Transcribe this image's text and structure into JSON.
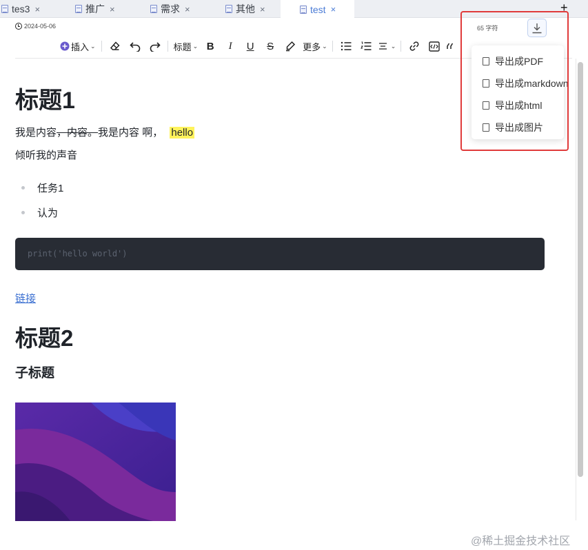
{
  "tabs": [
    {
      "label": "tes3",
      "active": false
    },
    {
      "label": "推广",
      "active": false
    },
    {
      "label": "需求",
      "active": false
    },
    {
      "label": "其他",
      "active": false
    },
    {
      "label": "test",
      "active": true
    }
  ],
  "tab_close": "×",
  "new_tab": "+",
  "doc_date": "2024-05-06",
  "char_count": "65 字符",
  "toolbar": {
    "insert_label": "插入",
    "heading_label": "标题",
    "bold": "B",
    "italic": "I",
    "underline": "U",
    "strike": "S",
    "more_label": "更多",
    "caret": "⌄"
  },
  "export_menu": {
    "items": [
      {
        "label": "导出成PDF",
        "icon": "pdf-file-icon"
      },
      {
        "label": "导出成markdown",
        "icon": "markdown-file-icon"
      },
      {
        "label": "导出成html",
        "icon": "html-file-icon"
      },
      {
        "label": "导出成图片",
        "icon": "image-file-icon"
      }
    ]
  },
  "doc": {
    "h1": "标题1",
    "p1_a": "我是内容",
    "p1_strike": "，内容。",
    "p1_b": "我是内容 啊，",
    "p1_mark": "hello",
    "p2": "倾听我的声音",
    "list": [
      "任务1",
      "认为"
    ],
    "code": "print('hello world')",
    "link": "链接",
    "h2": "标题2",
    "h3": "子标题"
  },
  "watermark": "@稀土掘金技术社区",
  "colors": {
    "accent": "#4a7bd6",
    "highlight": "#fff35c",
    "annotation_box": "#e03a3a",
    "code_bg": "#282c34"
  }
}
